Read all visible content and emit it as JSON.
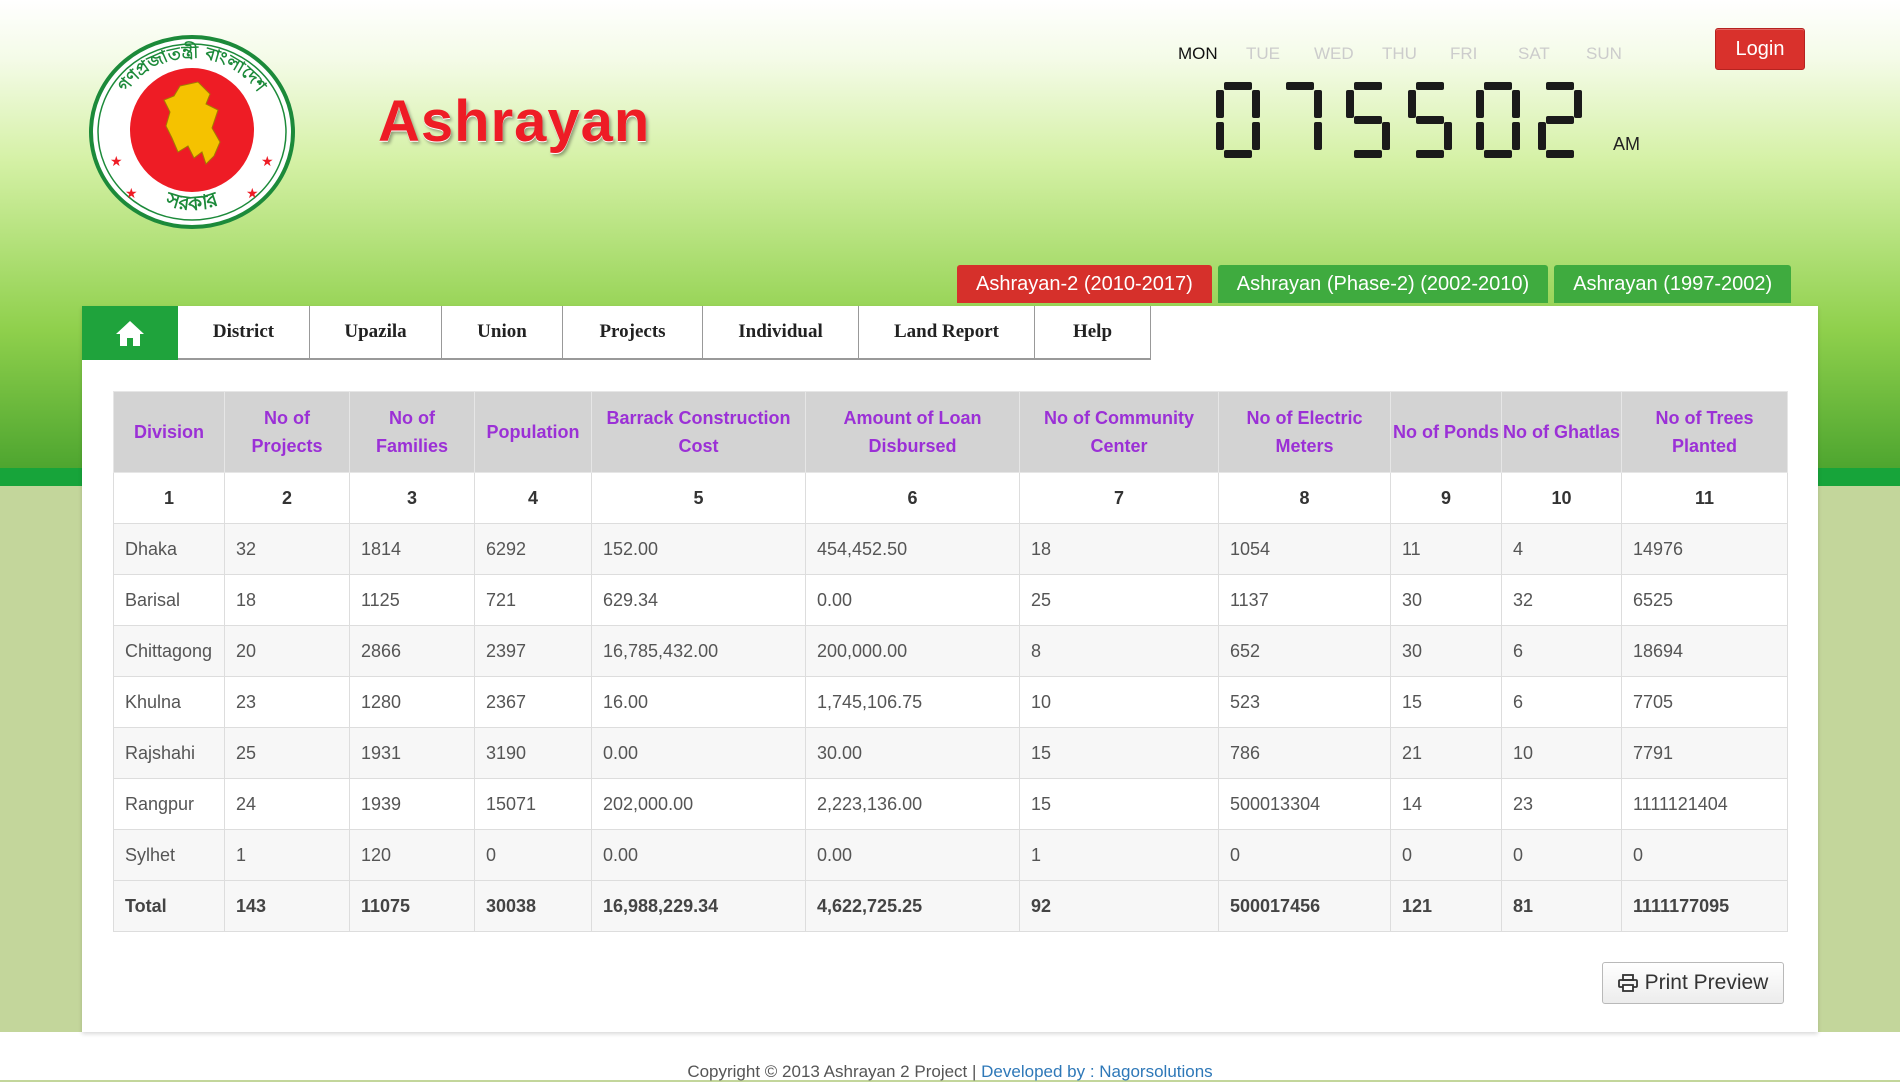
{
  "header": {
    "site_title": "Ashrayan",
    "logo_text_top": "গণপ্রজাতন্ত্রী বাংলাদেশ",
    "logo_text_bottom": "সরকার",
    "login_label": "Login"
  },
  "clock": {
    "days": [
      "MON",
      "TUE",
      "WED",
      "THU",
      "FRI",
      "SAT",
      "SUN"
    ],
    "active_day": "MON",
    "time_digits": "075502",
    "ampm": "AM"
  },
  "phase_tabs": [
    {
      "label": "Ashrayan-2 (2010-2017)",
      "active": true
    },
    {
      "label": "Ashrayan (Phase-2) (2002-2010)",
      "active": false
    },
    {
      "label": "Ashrayan (1997-2002)",
      "active": false
    }
  ],
  "nav": {
    "home_icon": "home-icon",
    "items": [
      "District",
      "Upazila",
      "Union",
      "Projects",
      "Individual",
      "Land Report",
      "Help"
    ]
  },
  "table": {
    "headers": [
      "Division",
      "No of Projects",
      "No of Families",
      "Population",
      "Barrack Construction Cost",
      "Amount of Loan Disbursed",
      "No of Community Center",
      "No of Electric Meters",
      "No of Ponds",
      "No of Ghatlas",
      "No of Trees Planted"
    ],
    "index_row": [
      "1",
      "2",
      "3",
      "4",
      "5",
      "6",
      "7",
      "8",
      "9",
      "10",
      "11"
    ],
    "rows": [
      [
        "Dhaka",
        "32",
        "1814",
        "6292",
        "152.00",
        "454,452.50",
        "18",
        "1054",
        "11",
        "4",
        "14976"
      ],
      [
        "Barisal",
        "18",
        "1125",
        "721",
        "629.34",
        "0.00",
        "25",
        "1137",
        "30",
        "32",
        "6525"
      ],
      [
        "Chittagong",
        "20",
        "2866",
        "2397",
        "16,785,432.00",
        "200,000.00",
        "8",
        "652",
        "30",
        "6",
        "18694"
      ],
      [
        "Khulna",
        "23",
        "1280",
        "2367",
        "16.00",
        "1,745,106.75",
        "10",
        "523",
        "15",
        "6",
        "7705"
      ],
      [
        "Rajshahi",
        "25",
        "1931",
        "3190",
        "0.00",
        "30.00",
        "15",
        "786",
        "21",
        "10",
        "7791"
      ],
      [
        "Rangpur",
        "24",
        "1939",
        "15071",
        "202,000.00",
        "2,223,136.00",
        "15",
        "500013304",
        "14",
        "23",
        "1111121404"
      ],
      [
        "Sylhet",
        "1",
        "120",
        "0",
        "0.00",
        "0.00",
        "1",
        "0",
        "0",
        "0",
        "0"
      ]
    ],
    "total": [
      "Total",
      "143",
      "11075",
      "30038",
      "16,988,229.34",
      "4,622,725.25",
      "92",
      "500017456",
      "121",
      "81",
      "1111177095"
    ]
  },
  "print_preview_label": "Print Preview",
  "footer": {
    "copyright": "Copyright © 2013 Ashrayan 2 Project |",
    "developed_by": "Developed by : Nagorsolutions"
  },
  "colors": {
    "title_red": "#ee1c25",
    "nav_green": "#1fa33c",
    "header_text_purple": "#9b30d6",
    "login_red": "#d9312c"
  }
}
